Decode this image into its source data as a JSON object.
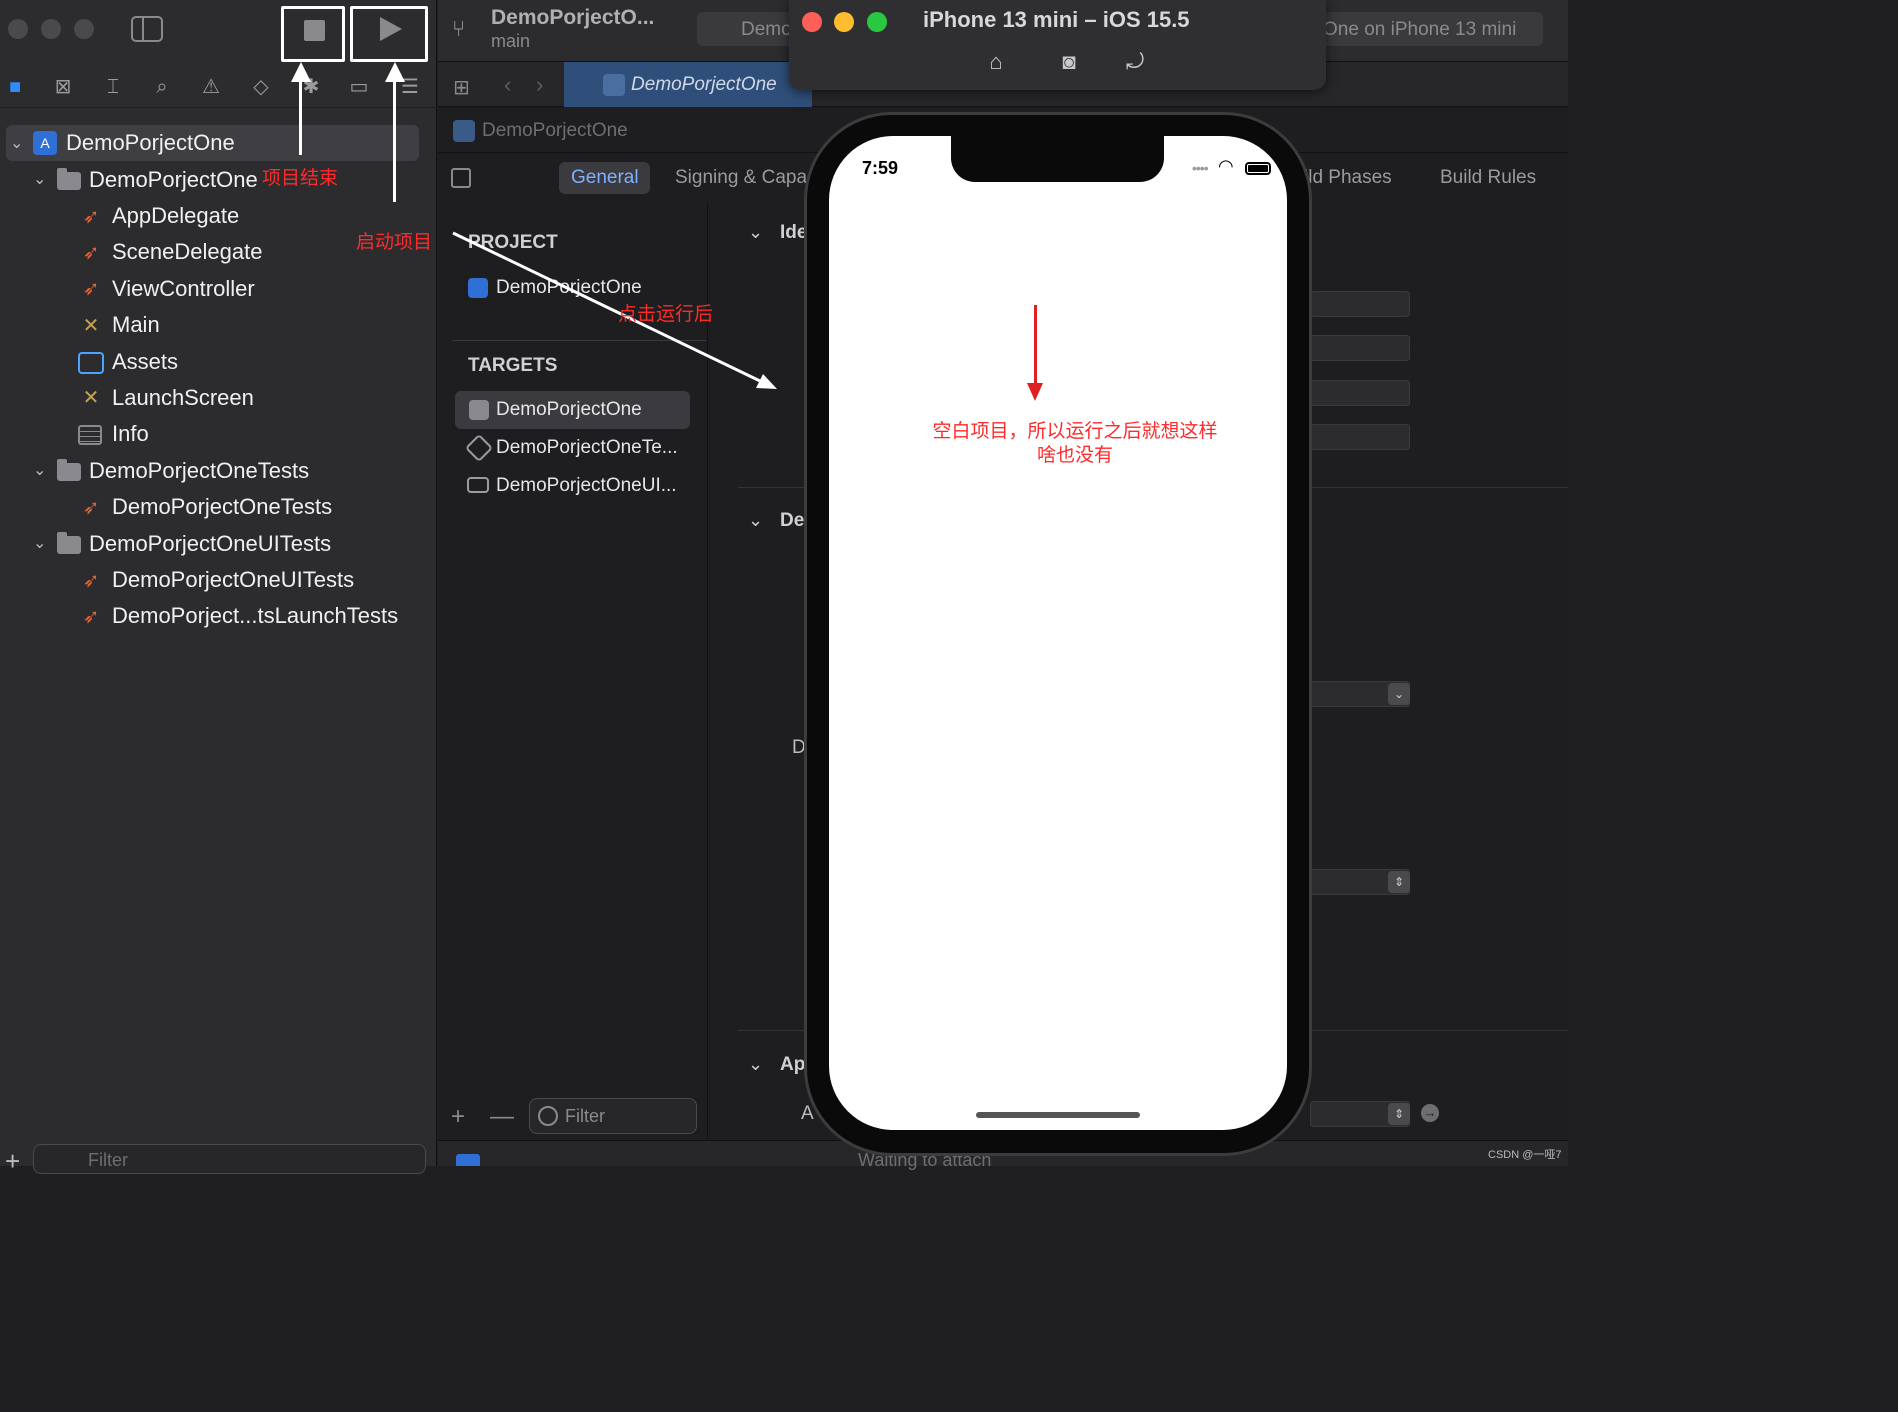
{
  "navigator": {
    "toolbar": {
      "stop_icon": "stop-icon",
      "run_icon": "play-icon"
    },
    "tree": [
      {
        "label": "DemoPorjectOne",
        "icon": "project-icon",
        "expanded": true,
        "level": 0
      },
      {
        "label": "DemoPorjectOne",
        "icon": "folder-icon",
        "expanded": true,
        "level": 1
      },
      {
        "label": "AppDelegate",
        "icon": "swift-icon",
        "level": 2
      },
      {
        "label": "SceneDelegate",
        "icon": "swift-icon",
        "level": 2
      },
      {
        "label": "ViewController",
        "icon": "swift-icon",
        "level": 2
      },
      {
        "label": "Main",
        "icon": "storyboard-icon",
        "level": 2
      },
      {
        "label": "Assets",
        "icon": "assets-icon",
        "level": 2
      },
      {
        "label": "LaunchScreen",
        "icon": "storyboard-icon",
        "level": 2
      },
      {
        "label": "Info",
        "icon": "plist-icon",
        "level": 2
      },
      {
        "label": "DemoPorjectOneTests",
        "icon": "folder-icon",
        "expanded": true,
        "level": 1
      },
      {
        "label": "DemoPorjectOneTests",
        "icon": "swift-icon",
        "level": 2
      },
      {
        "label": "DemoPorjectOneUITests",
        "icon": "folder-icon",
        "expanded": true,
        "level": 1
      },
      {
        "label": "DemoPorjectOneUITests",
        "icon": "swift-icon",
        "level": 2
      },
      {
        "label": "DemoPorject...tsLaunchTests",
        "icon": "swift-icon",
        "level": 2
      }
    ],
    "filter_placeholder": "Filter"
  },
  "annotations": {
    "stop_note": "项目结束",
    "run_note": "启动项目",
    "after_run_note": "点击运行后",
    "phone_note": "空白项目，所以运行之后就想这样啥也没有"
  },
  "editor": {
    "scheme": "DemoPorjectO...",
    "branch": "main",
    "run_destination": "Demo",
    "status": "One on iPhone 13 mini",
    "active_tab": "DemoPorjectOne",
    "jump_bar": "DemoPorjectOne",
    "settings_tabs": [
      "General",
      "Signing & Capa",
      "ild Phases",
      "Build Rules"
    ],
    "project_header": "PROJECT",
    "project_item": "DemoPorjectOne",
    "targets_header": "TARGETS",
    "targets": [
      "DemoPorjectOne",
      "DemoPorjectOneTe...",
      "DemoPorjectOneUI..."
    ],
    "targets_filter_placeholder": "Filter",
    "sections": [
      "Ide",
      "De",
      "Ap"
    ],
    "partial_labels": [
      "D",
      "A"
    ],
    "debug_status": "Waiting to attach"
  },
  "simulator": {
    "title": "iPhone 13 mini – iOS 15.5",
    "status_time": "7:59",
    "toolbar_icons": [
      "home-icon",
      "screenshot-icon",
      "rotate-icon"
    ]
  },
  "watermark": "CSDN @一哑7",
  "colors": {
    "accent": "#2f8cff",
    "annotation": "#ff2a2a",
    "stop_light_red": "#ff5f57",
    "light_yellow": "#febc2e",
    "light_green": "#28c840"
  }
}
